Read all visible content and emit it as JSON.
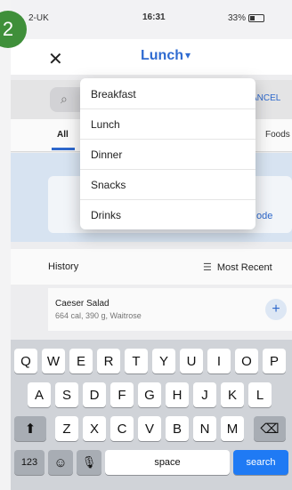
{
  "step_badge": "2",
  "status_bar": {
    "carrier": "2-UK",
    "time": "16:31",
    "battery": "33%"
  },
  "nav": {
    "close_icon": "x-icon",
    "title": "Lunch",
    "chevron": "▾"
  },
  "search": {
    "cancel_label": "ANCEL"
  },
  "tabs": {
    "all": "All",
    "foods": "Foods"
  },
  "blue_card": {
    "left_text": "S",
    "right_text": "ode"
  },
  "history": {
    "label": "History",
    "sort": "Most Recent"
  },
  "food_item": {
    "name": "Caeser Salad",
    "meta": "664 cal, 390 g, Waitrose"
  },
  "dropdown": {
    "items": [
      "Breakfast",
      "Lunch",
      "Dinner",
      "Snacks",
      "Drinks"
    ]
  },
  "keyboard": {
    "row1": [
      "Q",
      "W",
      "E",
      "R",
      "T",
      "Y",
      "U",
      "I",
      "O",
      "P"
    ],
    "row2": [
      "A",
      "S",
      "D",
      "F",
      "G",
      "H",
      "J",
      "K",
      "L"
    ],
    "row3": [
      "Z",
      "X",
      "C",
      "V",
      "B",
      "N",
      "M"
    ],
    "numbers": "123",
    "space": "space",
    "search": "search"
  }
}
